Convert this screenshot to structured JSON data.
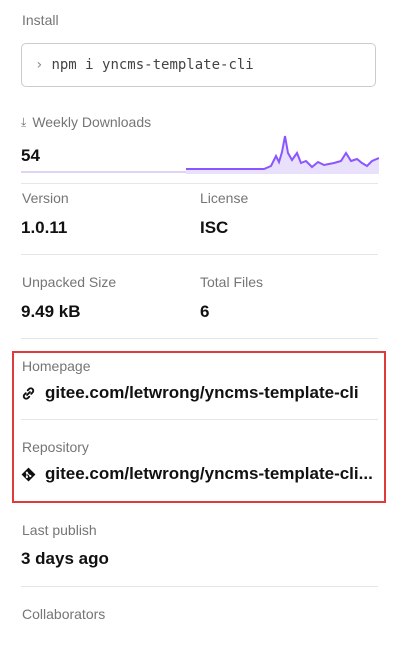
{
  "install": {
    "label": "Install",
    "command": "npm i yncms-template-cli",
    "prompt_icon": "chevron-right-icon"
  },
  "weekly_downloads": {
    "label": "Weekly Downloads",
    "icon": "download-icon",
    "value": "54",
    "color": "#8956ff"
  },
  "stats": {
    "version": {
      "label": "Version",
      "value": "1.0.11"
    },
    "license": {
      "label": "License",
      "value": "ISC"
    },
    "unpacked_size": {
      "label": "Unpacked Size",
      "value": "9.49 kB"
    },
    "total_files": {
      "label": "Total Files",
      "value": "6"
    }
  },
  "homepage": {
    "label": "Homepage",
    "icon": "link-icon",
    "link_text": "gitee.com/letwrong/yncms-template-cli"
  },
  "repository": {
    "label": "Repository",
    "icon": "git-icon",
    "link_text": "gitee.com/letwrong/yncms-template-cli..."
  },
  "last_publish": {
    "label": "Last publish",
    "value": "3 days ago"
  },
  "collaborators": {
    "label": "Collaborators"
  },
  "highlight_color": "#e03b3b"
}
